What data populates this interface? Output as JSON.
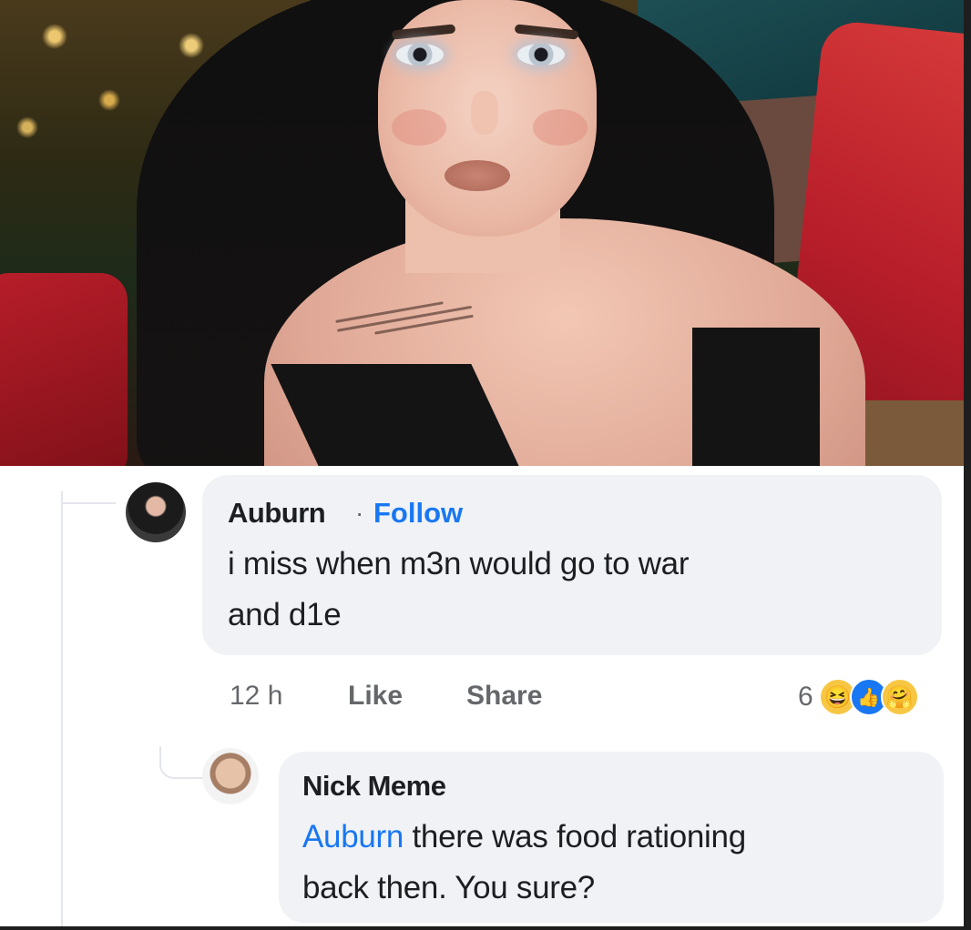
{
  "comments": [
    {
      "author": "Auburn",
      "separator": "·",
      "follow_label": "Follow",
      "text_line1": "i miss when m3n would go to war",
      "text_line2": "and d1e",
      "time": "12 h",
      "like_label": "Like",
      "share_label": "Share",
      "reaction_count": "6",
      "reactions": [
        "haha-icon",
        "like-icon",
        "care-icon"
      ]
    },
    {
      "author": "Nick Meme",
      "mention": "Auburn",
      "text_line1_rest": " there was food rationing",
      "text_line2": "back then. You sure?"
    }
  ],
  "colors": {
    "link": "#1877f2",
    "bubble": "#f0f2f5",
    "meta": "#65676b",
    "text": "#1c1e21"
  }
}
